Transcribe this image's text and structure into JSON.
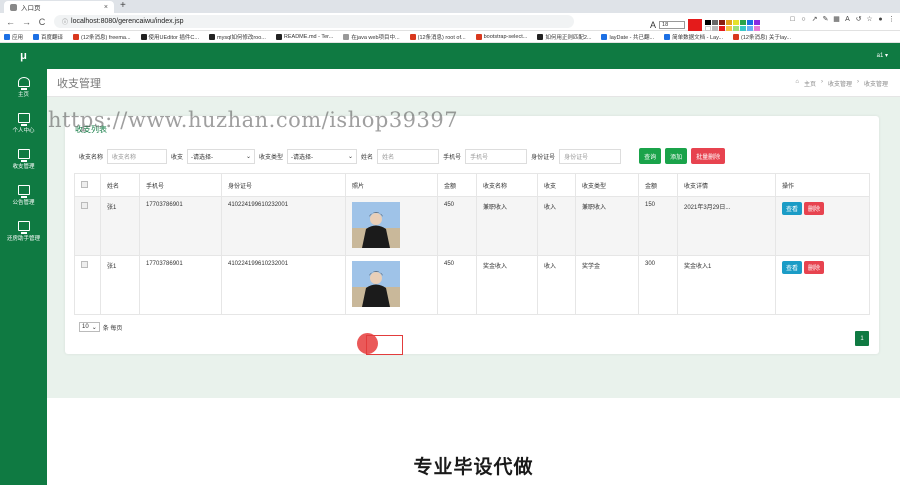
{
  "browser": {
    "tab_title": "入口页",
    "tab_close": "×",
    "new_tab": "+",
    "back": "←",
    "forward": "→",
    "reload": "C",
    "url": "localhost:8080/gerencaiwu/index.jsp",
    "font_size_value": "18",
    "bookmarks": [
      "应用",
      "百度翻译",
      "(12条消息) freema...",
      "使用UEditor 插件C...",
      "mysql如何修改roo...",
      "README.md - Ter...",
      "在java web项目中...",
      "(12条消息) root of...",
      "bootstrap-select...",
      "如何用正则匹配2...",
      "layDate - 共已翻...",
      "简单数据文档 - Lay...",
      "(12条消息) 关于lay..."
    ],
    "accent_color": "#e41b1b"
  },
  "app": {
    "logo": "μ",
    "user_menu": "a1 ▾",
    "nav": [
      {
        "label": "主页",
        "icon": "home-icon"
      },
      {
        "label": "个人中心",
        "icon": "monitor-icon"
      },
      {
        "label": "收支管理",
        "icon": "monitor-icon"
      },
      {
        "label": "公告管理",
        "icon": "monitor-icon"
      },
      {
        "label": "还房助手管理",
        "icon": "monitor-icon"
      }
    ],
    "brand_color": "#0f7a42"
  },
  "page": {
    "title": "收支管理",
    "breadcrumb": [
      "主页",
      "收支管理",
      "收支管理"
    ],
    "panel_title": "收支列表"
  },
  "filters": {
    "name_label": "收支名称",
    "name_placeholder": "收支名称",
    "type_label": "收支",
    "type_value": "-请选择-",
    "kind_label": "收支类型",
    "kind_value": "-请选择-",
    "person_label": "姓名",
    "person_placeholder": "姓名",
    "phone_label": "手机号",
    "phone_placeholder": "手机号",
    "id_label": "身份证号",
    "id_placeholder": "身份证号",
    "query_button": "查询",
    "add_button": "添加",
    "batch_delete_button": "批量删除"
  },
  "table": {
    "headers": [
      "",
      "姓名",
      "手机号",
      "身份证号",
      "照片",
      "金额",
      "收支名称",
      "收支",
      "收支类型",
      "金额",
      "收支详情",
      "操作"
    ],
    "rows": [
      {
        "name": "张1",
        "phone": "17703786901",
        "id_no": "410224199610232001",
        "amount": "450",
        "item_name": "兼职收入",
        "direction": "收入",
        "kind": "兼职收入",
        "amount2": "150",
        "detail": "2021年3月29日..."
      },
      {
        "name": "张1",
        "phone": "17703786901",
        "id_no": "410224199610232001",
        "amount": "450",
        "item_name": "奖金收入",
        "direction": "收入",
        "kind": "奖学金",
        "amount2": "300",
        "detail": "奖金收入1"
      }
    ],
    "view_label": "查看",
    "delete_label": "删除"
  },
  "pagination": {
    "page_size": "10",
    "per_page_label": "条 每页",
    "current_page": "1"
  },
  "overlay": {
    "watermark": "https://www.huzhan.com/ishop39397",
    "promo": "专业毕设代做"
  }
}
